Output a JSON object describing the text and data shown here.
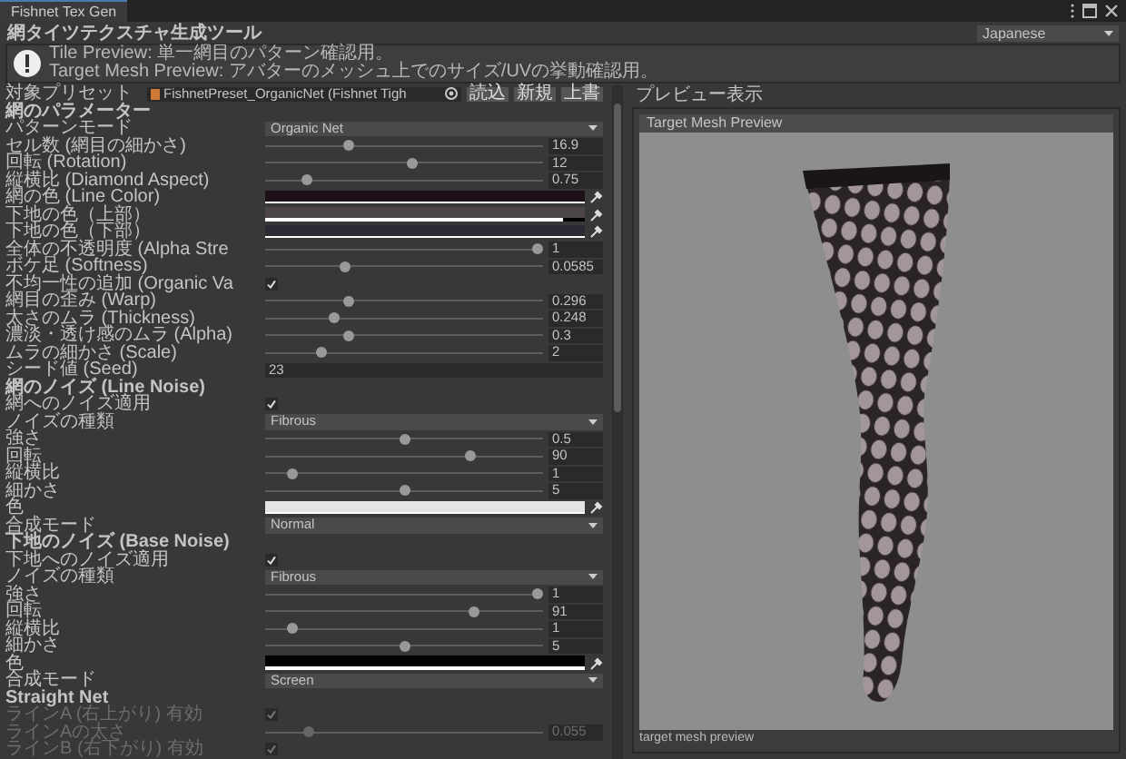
{
  "window": {
    "tab": "Fishnet Tex Gen"
  },
  "tool_title": "網タイツテクスチャ生成ツール",
  "language": "Japanese",
  "help": [
    "Tile Preview: 単一網目のパターン確認用。",
    "Target Mesh Preview: アバターのメッシュ上でのサイズ/UVの挙動確認用。"
  ],
  "preset": {
    "label": "対象プリセット",
    "value": "FishnetPreset_OrganicNet (Fishnet Tigh",
    "buttons": [
      "読込",
      "新規",
      "上書"
    ]
  },
  "sections": [
    {
      "title": "網のパラメーター",
      "disabled": false,
      "rows": [
        {
          "kind": "dropdown",
          "label": "パターンモード",
          "value": "Organic Net"
        },
        {
          "kind": "slider",
          "label": "セル数 (網目の細かさ)",
          "level": 0.3,
          "value": "16.9"
        },
        {
          "kind": "slider",
          "label": "回転 (Rotation)",
          "level": 0.53,
          "value": "12"
        },
        {
          "kind": "slider",
          "label": "縦横比 (Diamond Aspect)",
          "level": 0.15,
          "value": "0.75"
        },
        {
          "kind": "color",
          "label": "網の色 (Line Color)",
          "color": "#1e0f1a",
          "level": 1
        },
        {
          "kind": "color",
          "label": "下地の色（上部）",
          "color": "#4b4548",
          "level": 0.93
        },
        {
          "kind": "color",
          "label": "下地の色（下部）",
          "color": "#2b2a33",
          "level": 1
        },
        {
          "kind": "slider",
          "label": "全体の不透明度 (Alpha Stre",
          "level": 0.98,
          "value": "1"
        },
        {
          "kind": "slider",
          "label": "ボケ足 (Softness)",
          "level": 0.29,
          "value": "0.0585"
        },
        {
          "kind": "toggle",
          "label": "不均一性の追加 (Organic Va",
          "checked": true
        },
        {
          "kind": "slider",
          "label": "網目の歪み (Warp)",
          "level": 0.3,
          "value": "0.296"
        },
        {
          "kind": "slider",
          "label": "太さのムラ (Thickness)",
          "level": 0.25,
          "value": "0.248"
        },
        {
          "kind": "slider",
          "label": "濃淡・透け感のムラ (Alpha)",
          "level": 0.3,
          "value": "0.3"
        },
        {
          "kind": "slider",
          "label": "ムラの細かさ (Scale)",
          "level": 0.2,
          "value": "2"
        },
        {
          "kind": "number",
          "label": "シード値 (Seed)",
          "value": "23"
        }
      ]
    },
    {
      "title": "網のノイズ (Line Noise)",
      "disabled": false,
      "rows": [
        {
          "kind": "toggle",
          "label": "網へのノイズ適用",
          "checked": true
        },
        {
          "kind": "dropdown",
          "label": "ノイズの種類",
          "value": "Fibrous"
        },
        {
          "kind": "slider",
          "label": "強さ",
          "level": 0.5,
          "value": "0.5"
        },
        {
          "kind": "slider",
          "label": "回転",
          "level": 0.74,
          "value": "90"
        },
        {
          "kind": "slider",
          "label": "縦横比",
          "level": 0.1,
          "value": "1"
        },
        {
          "kind": "slider",
          "label": "細かさ",
          "level": 0.5,
          "value": "5"
        },
        {
          "kind": "color",
          "label": "色",
          "color": "#e4e4e4",
          "level": 1
        },
        {
          "kind": "dropdown",
          "label": "合成モード",
          "value": "Normal"
        }
      ]
    },
    {
      "title": "下地のノイズ (Base Noise)",
      "disabled": false,
      "rows": [
        {
          "kind": "toggle",
          "label": "下地へのノイズ適用",
          "checked": true
        },
        {
          "kind": "dropdown",
          "label": "ノイズの種類",
          "value": "Fibrous"
        },
        {
          "kind": "slider",
          "label": "強さ",
          "level": 0.98,
          "value": "1"
        },
        {
          "kind": "slider",
          "label": "回転",
          "level": 0.75,
          "value": "91"
        },
        {
          "kind": "slider",
          "label": "縦横比",
          "level": 0.1,
          "value": "1"
        },
        {
          "kind": "slider",
          "label": "細かさ",
          "level": 0.5,
          "value": "5"
        },
        {
          "kind": "color",
          "label": "色",
          "color": "#000000",
          "level": 1
        },
        {
          "kind": "dropdown",
          "label": "合成モード",
          "value": "Screen"
        }
      ]
    },
    {
      "title": "Straight Net",
      "disabled": true,
      "rows": [
        {
          "kind": "toggle",
          "label": "ラインA (右上がり) 有効",
          "checked": true
        },
        {
          "kind": "slider",
          "label": "ラインAの太さ",
          "level": 0.16,
          "value": "0.055"
        },
        {
          "kind": "toggle",
          "label": "ラインB (右下がり) 有効",
          "checked": true
        }
      ]
    }
  ],
  "preview": {
    "title": "プレビュー表示",
    "tab": "Target Mesh Preview",
    "caption": "target mesh preview"
  }
}
